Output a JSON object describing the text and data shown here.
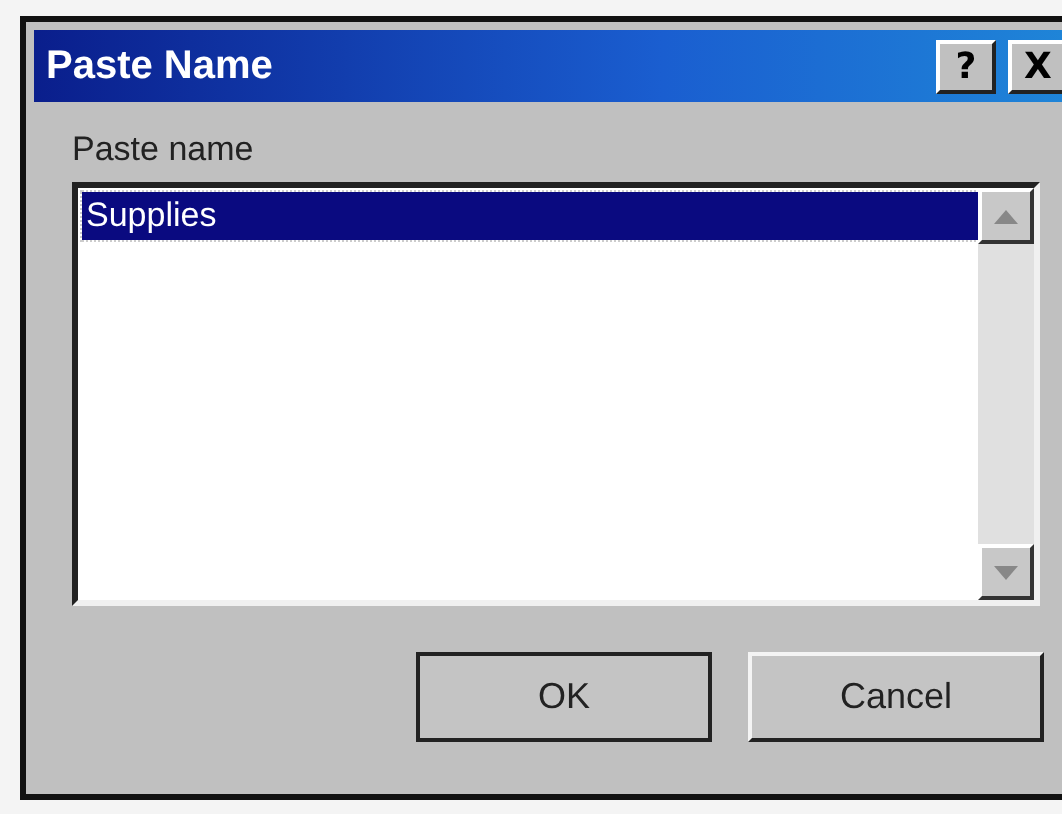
{
  "window": {
    "title": "Paste Name",
    "title_buttons": [
      "?",
      "X"
    ]
  },
  "list": {
    "label": "Paste name",
    "items": [
      {
        "text": "Supplies",
        "selected": true
      }
    ]
  },
  "buttons": [
    "OK",
    "Cancel"
  ]
}
